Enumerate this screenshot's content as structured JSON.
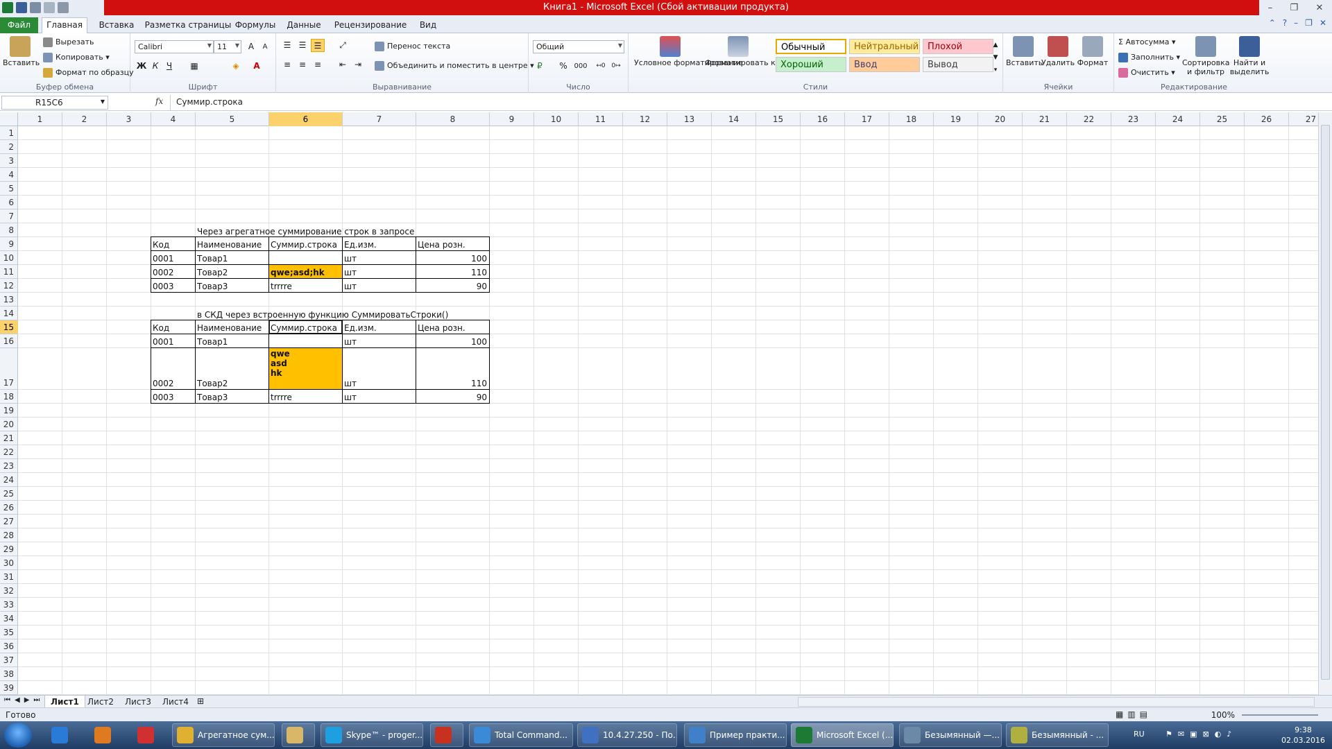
{
  "window": {
    "title": "Книга1  -  Microsoft Excel (Сбой активации продукта)"
  },
  "ribbon_tabs": [
    "Файл",
    "Главная",
    "Вставка",
    "Разметка страницы",
    "Формулы",
    "Данные",
    "Рецензирование",
    "Вид"
  ],
  "ribbon": {
    "clipboard": {
      "label": "Буфер обмена",
      "paste": "Вставить",
      "cut": "Вырезать",
      "copy": "Копировать",
      "format_painter": "Формат по образцу"
    },
    "font": {
      "label": "Шрифт",
      "name": "Calibri",
      "size": "11",
      "bold": "Ж",
      "italic": "К",
      "underline": "Ч"
    },
    "alignment": {
      "label": "Выравнивание",
      "wrap": "Перенос текста",
      "merge": "Объединить и поместить в центре"
    },
    "number": {
      "label": "Число",
      "format": "Общий",
      "percent": "%",
      "thousands": "000"
    },
    "styles": {
      "label": "Стили",
      "cond_format": "Условное форматирование",
      "format_table": "Форматировать как таблицу",
      "cells": [
        {
          "name": "Обычный",
          "bg": "#ffffff",
          "fg": "#000000"
        },
        {
          "name": "Нейтральный",
          "bg": "#ffeb9c",
          "fg": "#9c6500"
        },
        {
          "name": "Плохой",
          "bg": "#ffc7ce",
          "fg": "#9c0006"
        },
        {
          "name": "Хороший",
          "bg": "#c6efce",
          "fg": "#006100"
        },
        {
          "name": "Ввод",
          "bg": "#ffcc99",
          "fg": "#3f3f76"
        },
        {
          "name": "Вывод",
          "bg": "#f2f2f2",
          "fg": "#3f3f3f"
        }
      ]
    },
    "cells": {
      "label": "Ячейки",
      "insert": "Вставить",
      "delete": "Удалить",
      "format": "Формат"
    },
    "editing": {
      "label": "Редактирование",
      "autosum": "Автосумма",
      "fill": "Заполнить",
      "clear": "Очистить",
      "sort": "Сортировка и фильтр",
      "find": "Найти и выделить"
    }
  },
  "formula_bar": {
    "name_box": "R15C6",
    "fx": "fx",
    "value": "Суммир.строка"
  },
  "columns": [
    "1",
    "2",
    "3",
    "4",
    "5",
    "6",
    "7",
    "8",
    "9",
    "10",
    "11",
    "12",
    "13",
    "14",
    "15",
    "16",
    "17",
    "18",
    "19",
    "20",
    "21",
    "22",
    "23",
    "24",
    "25",
    "26",
    "27"
  ],
  "rows": [
    "1",
    "2",
    "3",
    "4",
    "5",
    "6",
    "7",
    "8",
    "9",
    "10",
    "11",
    "12",
    "13",
    "14",
    "15",
    "16",
    "17",
    "18",
    "19",
    "20",
    "21",
    "22",
    "23",
    "24",
    "25",
    "26",
    "27",
    "28",
    "29",
    "30",
    "31",
    "32",
    "33",
    "34",
    "35",
    "36",
    "37",
    "38",
    "39"
  ],
  "table1": {
    "caption": "Через агрегатное суммирование строк в запросе",
    "headers": [
      "Код",
      "Наименование",
      "Суммир.строка",
      "Ед.изм.",
      "Цена розн."
    ],
    "rows": [
      [
        "0001",
        "Товар1",
        "",
        "шт",
        "100"
      ],
      [
        "0002",
        "Товар2",
        "qwe;asd;hk",
        "шт",
        "110"
      ],
      [
        "0003",
        "Товар3",
        "trrrre",
        "шт",
        "90"
      ]
    ]
  },
  "table2": {
    "caption": "в СКД через встроенную функцию СуммироватьСтроки()",
    "headers": [
      "Код",
      "Наименование",
      "Суммир.строка",
      "Ед.изм.",
      "Цена розн."
    ],
    "rows": [
      [
        "0001",
        "Товар1",
        "",
        "шт",
        "100"
      ],
      [
        "0002",
        "Товар2",
        "qwe|asd|hk",
        "шт",
        "110"
      ],
      [
        "0003",
        "Товар3",
        "trrrre",
        "шт",
        "90"
      ]
    ],
    "multiline": [
      "qwe",
      "asd",
      "hk"
    ]
  },
  "sheets": [
    "Лист1",
    "Лист2",
    "Лист3",
    "Лист4"
  ],
  "status": {
    "ready": "Готово",
    "zoom": "100%"
  },
  "taskbar": {
    "items": [
      "Агрегатное сум...",
      "",
      "Skype™ - proger...",
      "",
      "Total Command...",
      "10.4.27.250 - По...",
      "Пример практи...",
      "Microsoft Excel (...",
      "Безымянный —...",
      "Безымянный - ..."
    ],
    "lang": "RU",
    "time": "9:38",
    "date": "02.03.2016"
  },
  "colors": {
    "accent": "#ffc000",
    "title_bar": "#d20f0f",
    "file_tab": "#2a8a36"
  }
}
